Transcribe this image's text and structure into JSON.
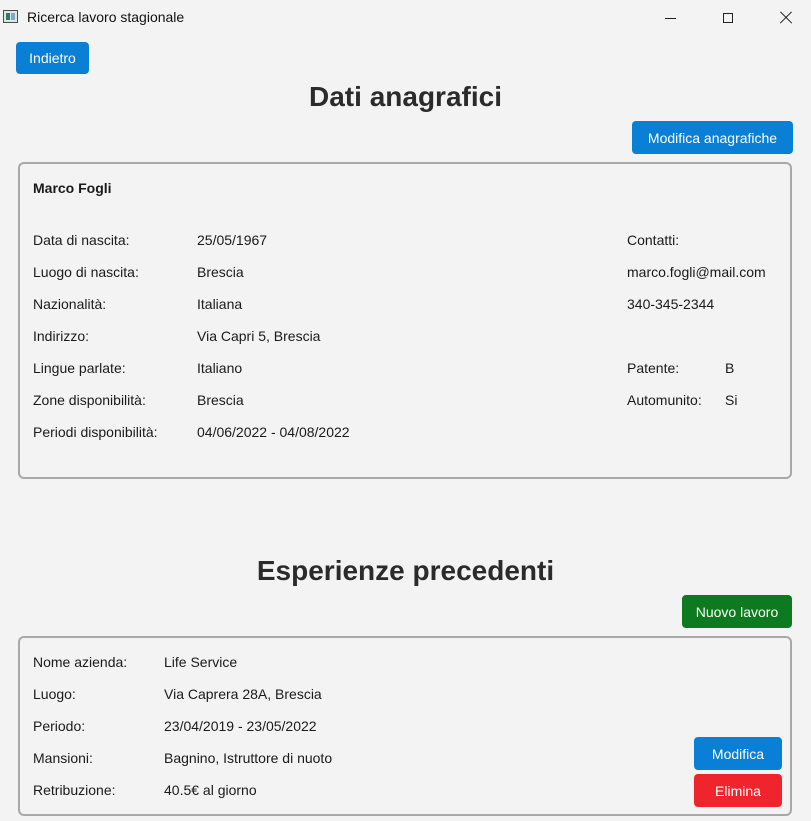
{
  "window": {
    "title": "Ricerca lavoro stagionale"
  },
  "nav": {
    "back_label": "Indietro"
  },
  "personal": {
    "heading": "Dati anagrafici",
    "edit_label": "Modifica anagrafiche",
    "name": "Marco Fogli",
    "fields": [
      {
        "label": "Data di nascita:",
        "value": "25/05/1967"
      },
      {
        "label": "Luogo di nascita:",
        "value": "Brescia"
      },
      {
        "label": "Nazionalità:",
        "value": "Italiana"
      },
      {
        "label": "Indirizzo:",
        "value": "Via Capri 5, Brescia"
      },
      {
        "label": "Lingue parlate:",
        "value": "Italiano"
      },
      {
        "label": "Zone disponibilità:",
        "value": "Brescia"
      },
      {
        "label": "Periodi disponibilità:",
        "value": "04/06/2022 - 04/08/2022"
      }
    ],
    "contacts": {
      "label": "Contatti:",
      "email": "marco.fogli@mail.com",
      "phone": "340-345-2344"
    },
    "license": {
      "label": "Patente:",
      "value": "B"
    },
    "car": {
      "label": "Automunito:",
      "value": "Si"
    }
  },
  "experience": {
    "heading": "Esperienze precedenti",
    "new_label": "Nuovo lavoro",
    "jobs": [
      {
        "fields": [
          {
            "label": "Nome azienda:",
            "value": "Life Service"
          },
          {
            "label": "Luogo:",
            "value": "Via Caprera 28A, Brescia"
          },
          {
            "label": "Periodo:",
            "value": "23/04/2019 - 23/05/2022"
          },
          {
            "label": "Mansioni:",
            "value": "Bagnino, Istruttore di nuoto"
          },
          {
            "label": "Retribuzione:",
            "value": "40.5€ al giorno"
          }
        ],
        "edit_label": "Modifica",
        "delete_label": "Elimina"
      }
    ]
  }
}
